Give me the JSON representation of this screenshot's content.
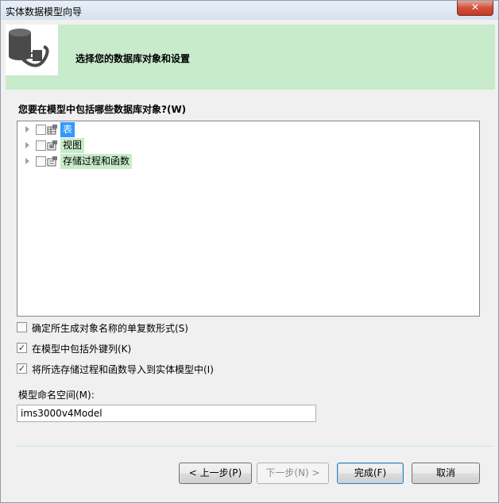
{
  "window": {
    "title": "实体数据模型向导",
    "close_label": "✕"
  },
  "header": {
    "heading": "选择您的数据库对象和设置"
  },
  "question": "您要在模型中包括哪些数据库对象?(W)",
  "tree": {
    "items": [
      {
        "label": "表",
        "checked": false
      },
      {
        "label": "视图",
        "checked": false
      },
      {
        "label": "存储过程和函数",
        "checked": false
      }
    ]
  },
  "options": [
    {
      "label": "确定所生成对象名称的单复数形式(S)",
      "checked": false
    },
    {
      "label": "在模型中包括外键列(K)",
      "checked": true
    },
    {
      "label": "将所选存储过程和函数导入到实体模型中(I)",
      "checked": true
    }
  ],
  "namespace": {
    "label": "模型命名空间(M):",
    "value": "ims3000v4Model"
  },
  "buttons": {
    "prev": "< 上一步(P)",
    "next": "下一步(N) >",
    "finish": "完成(F)",
    "cancel": "取消"
  },
  "colors": {
    "accent_green": "#c8ebcb",
    "selection_blue": "#3399ff"
  }
}
